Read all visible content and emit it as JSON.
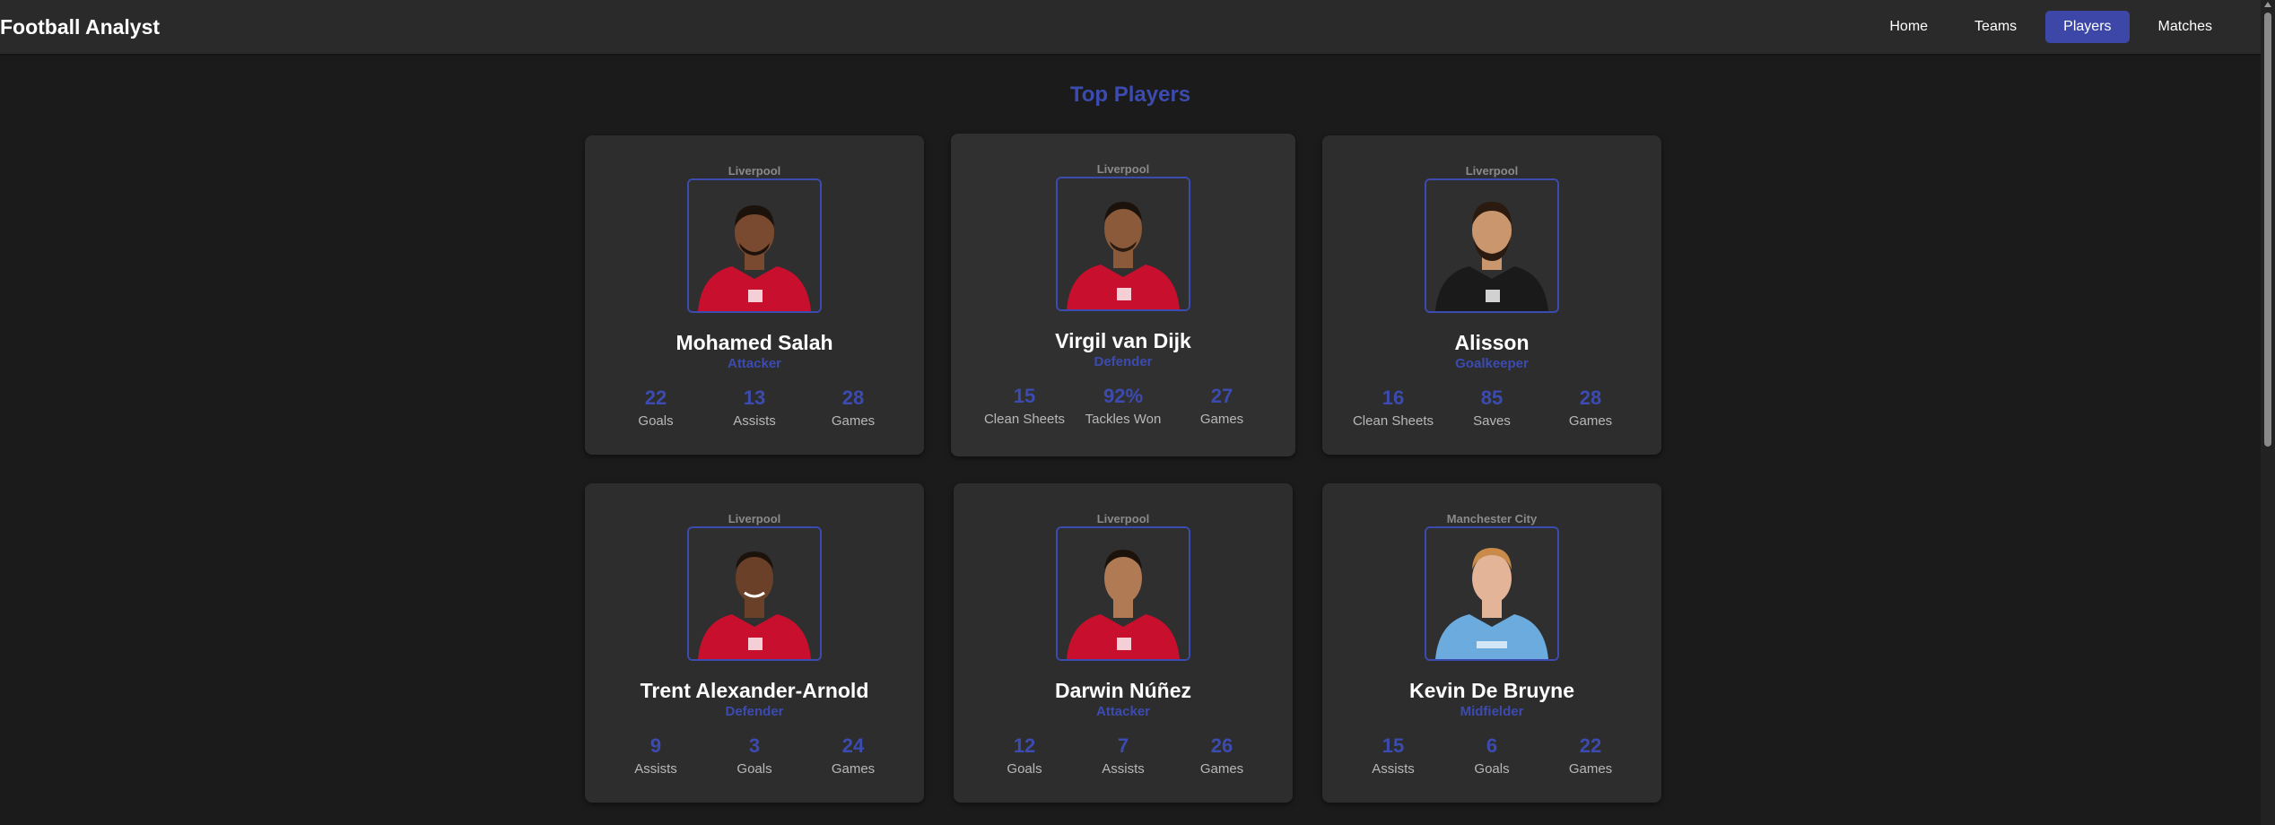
{
  "nav": {
    "brand": "Football Analyst",
    "links": [
      "Home",
      "Teams",
      "Players",
      "Matches"
    ],
    "active": "Players"
  },
  "main": {
    "title": "Top Players"
  },
  "players": [
    {
      "team": "Liverpool",
      "name": "Mohamed Salah",
      "position": "Attacker",
      "kit": "red",
      "stats": [
        {
          "value": "22",
          "label": "Goals"
        },
        {
          "value": "13",
          "label": "Assists"
        },
        {
          "value": "28",
          "label": "Games"
        }
      ]
    },
    {
      "team": "Liverpool",
      "name": "Virgil van Dijk",
      "position": "Defender",
      "kit": "red",
      "stats": [
        {
          "value": "15",
          "label": "Clean Sheets"
        },
        {
          "value": "92%",
          "label": "Tackles Won"
        },
        {
          "value": "27",
          "label": "Games"
        }
      ]
    },
    {
      "team": "Liverpool",
      "name": "Alisson",
      "position": "Goalkeeper",
      "kit": "black",
      "stats": [
        {
          "value": "16",
          "label": "Clean Sheets"
        },
        {
          "value": "85",
          "label": "Saves"
        },
        {
          "value": "28",
          "label": "Games"
        }
      ]
    },
    {
      "team": "Liverpool",
      "name": "Trent Alexander-Arnold",
      "position": "Defender",
      "kit": "red",
      "stats": [
        {
          "value": "9",
          "label": "Assists"
        },
        {
          "value": "3",
          "label": "Goals"
        },
        {
          "value": "24",
          "label": "Games"
        }
      ]
    },
    {
      "team": "Liverpool",
      "name": "Darwin Núñez",
      "position": "Attacker",
      "kit": "red",
      "stats": [
        {
          "value": "12",
          "label": "Goals"
        },
        {
          "value": "7",
          "label": "Assists"
        },
        {
          "value": "26",
          "label": "Games"
        }
      ]
    },
    {
      "team": "Manchester City",
      "name": "Kevin De Bruyne",
      "position": "Midfielder",
      "kit": "skyblue",
      "stats": [
        {
          "value": "15",
          "label": "Assists"
        },
        {
          "value": "6",
          "label": "Goals"
        },
        {
          "value": "22",
          "label": "Games"
        }
      ]
    }
  ],
  "colors": {
    "accent": "#3c4bb0",
    "background": "#1b1b1b",
    "card": "#2d2d2d",
    "kit_red": "#c8102e",
    "kit_black": "#1a1a1a",
    "kit_skyblue": "#6cabdd"
  },
  "icons": [
    "player-photo-red-kit",
    "player-photo-black-kit",
    "player-photo-skyblue-kit"
  ]
}
